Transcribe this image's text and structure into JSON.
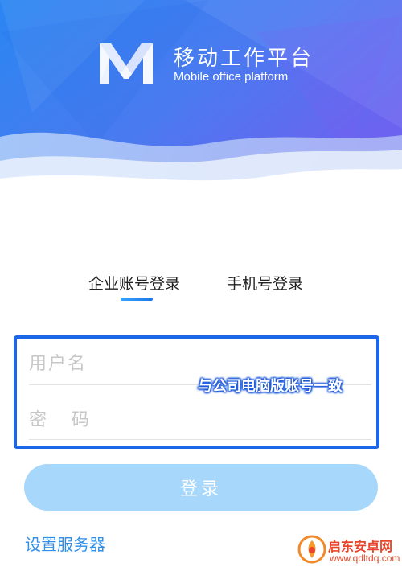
{
  "header": {
    "title": "移动工作平台",
    "subtitle": "Mobile office platform",
    "logo_icon": "m-logo-icon",
    "colors": {
      "gradient_start": "#2a86f2",
      "gradient_end": "#6c63f0"
    }
  },
  "tabs": [
    {
      "label": "企业账号登录",
      "active": true
    },
    {
      "label": "手机号登录",
      "active": false
    }
  ],
  "form": {
    "username_placeholder": "用户名",
    "password_placeholder": "密 码",
    "annotation": "与公司电脑版账号一致",
    "annotation_border_color": "#1b67e8"
  },
  "login_button": {
    "label": "登录",
    "color": "#a7d7fb"
  },
  "server_link": {
    "label": "设置服务器",
    "color": "#2f8ee8"
  },
  "watermark": {
    "name": "启东安卓网",
    "url": "www.qdltdq.com"
  }
}
